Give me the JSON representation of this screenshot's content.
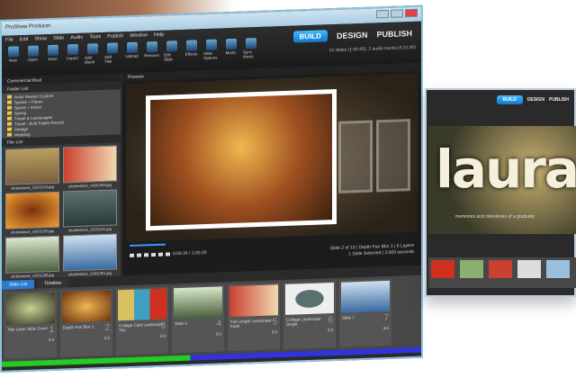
{
  "window": {
    "title": "ProShow Producer"
  },
  "menu": [
    "File",
    "Edit",
    "Show",
    "Slide",
    "Audio",
    "Tools",
    "Publish",
    "Window",
    "Help"
  ],
  "toolbar": [
    "New",
    "Open",
    "Save",
    "Import",
    "Add Blank",
    "Add Title",
    "Upload",
    "Remove",
    "Edit Slide",
    "Effects",
    "Slide Options",
    "Music",
    "Sync Music"
  ],
  "modes": {
    "build": "BUILD",
    "design": "DESIGN",
    "publish": "PUBLISH"
  },
  "show_info": "10 slides (1:00.00), 2 audio tracks (4:31.00)",
  "panel": {
    "tab": "Commercial Beat",
    "preview_label": "Preview",
    "folder_list_label": "Folder List",
    "file_list_label": "File List"
  },
  "folders": [
    "Artist Season Custom",
    "Spirals + Flares",
    "Sports + Action",
    "Spring",
    "Travel & Landscapes",
    "Travel - Bold Fades Record",
    "Vintage",
    "Wedding"
  ],
  "files": [
    "shutterstock_10201318.jpg",
    "shutterstock_14261909.jpg",
    "shutterstock_16201535.jpg",
    "shutterstock_13201191.jpg",
    "shutterstock_13201296.jpg",
    "shutterstock_12301301.jpg"
  ],
  "player": {
    "time": "0:09.34 / 1:00.00",
    "status_line1": "Slide 2 of 10 | Depth Pan Blur 1 | 6 Layers",
    "status_line2": "1 Slide Selected | 3.000 seconds"
  },
  "tabs": {
    "slide_list": "Slide List",
    "timeline": "Timeline"
  },
  "slides": [
    {
      "name": "Title Layer Slide Zoom",
      "num": "1",
      "dur": "3.0"
    },
    {
      "name": "Depth Pan Blur 1",
      "num": "2",
      "dur": "3.0"
    },
    {
      "name": "Collage Card Landscape Trio",
      "num": "3",
      "dur": "3.0"
    },
    {
      "name": "Slide 4",
      "num": "4",
      "dur": "3.0"
    },
    {
      "name": "Full Length Landscape Fade",
      "num": "5",
      "dur": "3.0"
    },
    {
      "name": "Collage Landscape Single",
      "num": "6",
      "dur": "3.0"
    },
    {
      "name": "Slide 7",
      "num": "7",
      "dur": "3.0"
    }
  ],
  "second_window": {
    "title_text": "laura",
    "subtitle": "memories and milestones of a graduate"
  }
}
